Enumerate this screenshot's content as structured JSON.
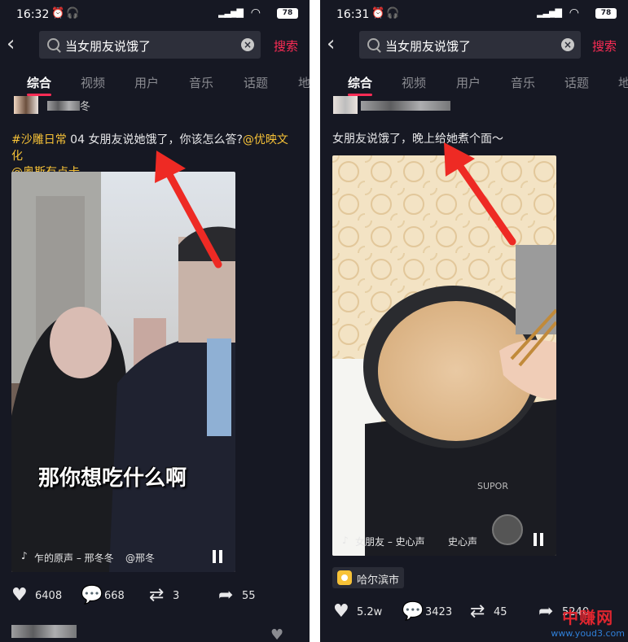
{
  "left": {
    "status": {
      "time": "16:32",
      "battery": "78"
    },
    "search": {
      "query": "当女朋友说饿了",
      "button": "搜索"
    },
    "tabs": [
      "综合",
      "视频",
      "用户",
      "音乐",
      "话题",
      "地"
    ],
    "author_partial": "冬",
    "caption": {
      "tag1": "#沙雕日常",
      "text": " 04 女朋友说她饿了，你该怎么答?",
      "mention1": "@优映文化",
      "mention2": "@奥斯有点卡"
    },
    "video": {
      "subtitle": "那你想吃什么啊",
      "music": "乍的原声 – 邢冬冬",
      "music_author": "@邢冬"
    },
    "actions": {
      "likes": "6408",
      "comments": "668",
      "reposts": "3",
      "shares": "55"
    }
  },
  "right": {
    "status": {
      "time": "16:31",
      "battery": "78"
    },
    "search": {
      "query": "当女朋友说饿了",
      "button": "搜索"
    },
    "tabs": [
      "综合",
      "视频",
      "用户",
      "音乐",
      "话题",
      "地"
    ],
    "caption": "女朋友说饿了，晚上给她煮个面～",
    "video": {
      "music": "女朋友 – 史心声",
      "music_author": "史心声"
    },
    "location": "哈尔滨市",
    "actions": {
      "likes": "5.2w",
      "comments": "3423",
      "reposts": "45",
      "shares": "5240"
    }
  },
  "watermark": {
    "title": "中赚网",
    "url": "www.youd3.com"
  },
  "colors": {
    "background": "#161823",
    "accent": "#fe2c55",
    "tag": "#f7c237"
  },
  "icons": [
    "status-alarm-icon",
    "headphone-icon",
    "signal-icon",
    "wifi-icon",
    "back-icon",
    "search-icon",
    "clear-icon",
    "music-note-icon",
    "pause-icon",
    "heart-icon",
    "comment-icon",
    "repost-icon",
    "share-icon",
    "location-icon",
    "red-arrow-annotation"
  ]
}
